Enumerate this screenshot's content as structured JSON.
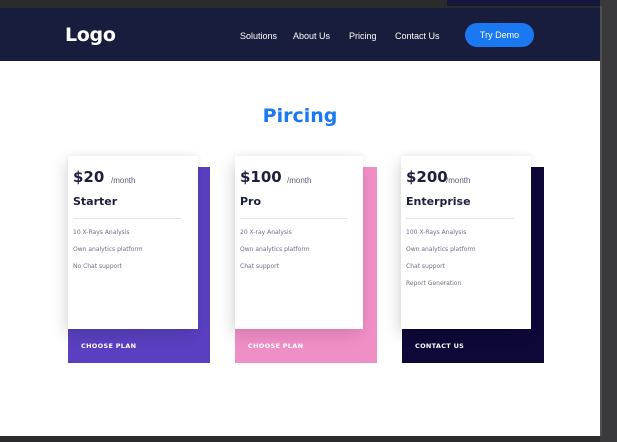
{
  "nav": {
    "logo": "Logo",
    "links": [
      {
        "label": "Solutions"
      },
      {
        "label": "About Us"
      },
      {
        "label": "Pricing"
      },
      {
        "label": "Contact Us"
      }
    ],
    "cta_label": "Try Demo"
  },
  "section_title": "Pircing",
  "plans": [
    {
      "price": "$20",
      "per": "/month",
      "name": "Starter",
      "features": [
        "10 X-Rays Analysis",
        "Own analytics platform",
        "No Chat support"
      ],
      "button_label": "CHOOSE PLAN",
      "accent_color": "#5a3fc0"
    },
    {
      "price": "$100",
      "per": "/month",
      "name": "Pro",
      "features": [
        "20 X-ray Analysis",
        "Own analytics platform",
        "Chat support"
      ],
      "button_label": "CHOOSE PLAN",
      "accent_color": "#f08ec6"
    },
    {
      "price": "$200",
      "per": "/month",
      "name": "Enterprise",
      "features": [
        "100 X-Rays Analysis",
        "Own analytics platform",
        "Chat support",
        "Report Generation"
      ],
      "button_label": "CONTACT US",
      "accent_color": "#0d0838"
    }
  ],
  "colors": {
    "navbar": "#181c3d",
    "primary": "#1a78f2"
  }
}
